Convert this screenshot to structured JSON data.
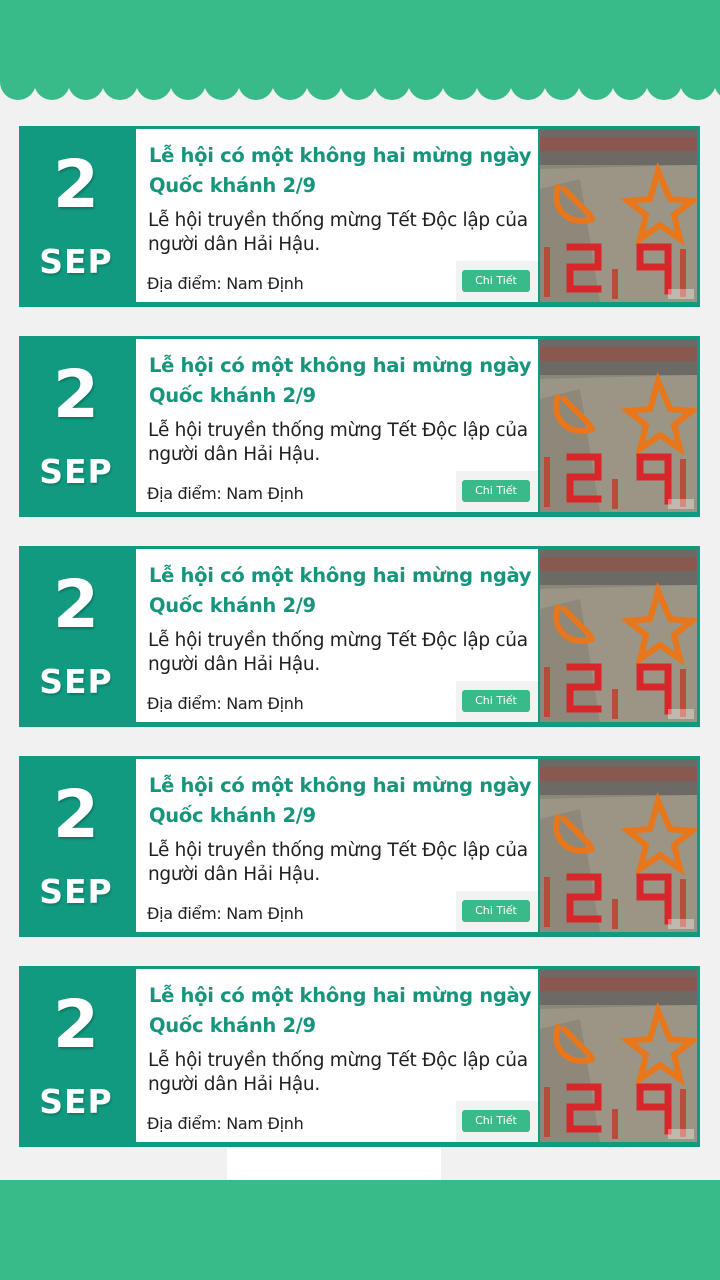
{
  "colors": {
    "brand_green": "#38bb88",
    "card_teal": "#129a80",
    "title_green": "#16957c",
    "background": "#f1f1f1"
  },
  "events": [
    {
      "day": "2",
      "month": "SEP",
      "title": "Lễ hội có một không hai mừng ngày Quốc khánh 2/9",
      "description": "Lễ hội truyền thống mừng Tết Độc lập của người dân Hải Hậu.",
      "location": "Địa điểm: Nam Định",
      "detail_label": "Chi Tiết",
      "image_icon": "festival-formation-photo"
    },
    {
      "day": "2",
      "month": "SEP",
      "title": "Lễ hội có một không hai mừng ngày Quốc khánh 2/9",
      "description": "Lễ hội truyền thống mừng Tết Độc lập của người dân Hải Hậu.",
      "location": "Địa điểm: Nam Định",
      "detail_label": "Chi Tiết",
      "image_icon": "festival-formation-photo"
    },
    {
      "day": "2",
      "month": "SEP",
      "title": "Lễ hội có một không hai mừng ngày Quốc khánh 2/9",
      "description": "Lễ hội truyền thống mừng Tết Độc lập của người dân Hải Hậu.",
      "location": "Địa điểm: Nam Định",
      "detail_label": "Chi Tiết",
      "image_icon": "festival-formation-photo"
    },
    {
      "day": "2",
      "month": "SEP",
      "title": "Lễ hội có một không hai mừng ngày Quốc khánh 2/9",
      "description": "Lễ hội truyền thống mừng Tết Độc lập của người dân Hải Hậu.",
      "location": "Địa điểm: Nam Định",
      "detail_label": "Chi Tiết",
      "image_icon": "festival-formation-photo"
    },
    {
      "day": "2",
      "month": "SEP",
      "title": "Lễ hội có một không hai mừng ngày Quốc khánh 2/9",
      "description": "Lễ hội truyền thống mừng Tết Độc lập của người dân Hải Hậu.",
      "location": "Địa điểm: Nam Định",
      "detail_label": "Chi Tiết",
      "image_icon": "festival-formation-photo"
    }
  ]
}
